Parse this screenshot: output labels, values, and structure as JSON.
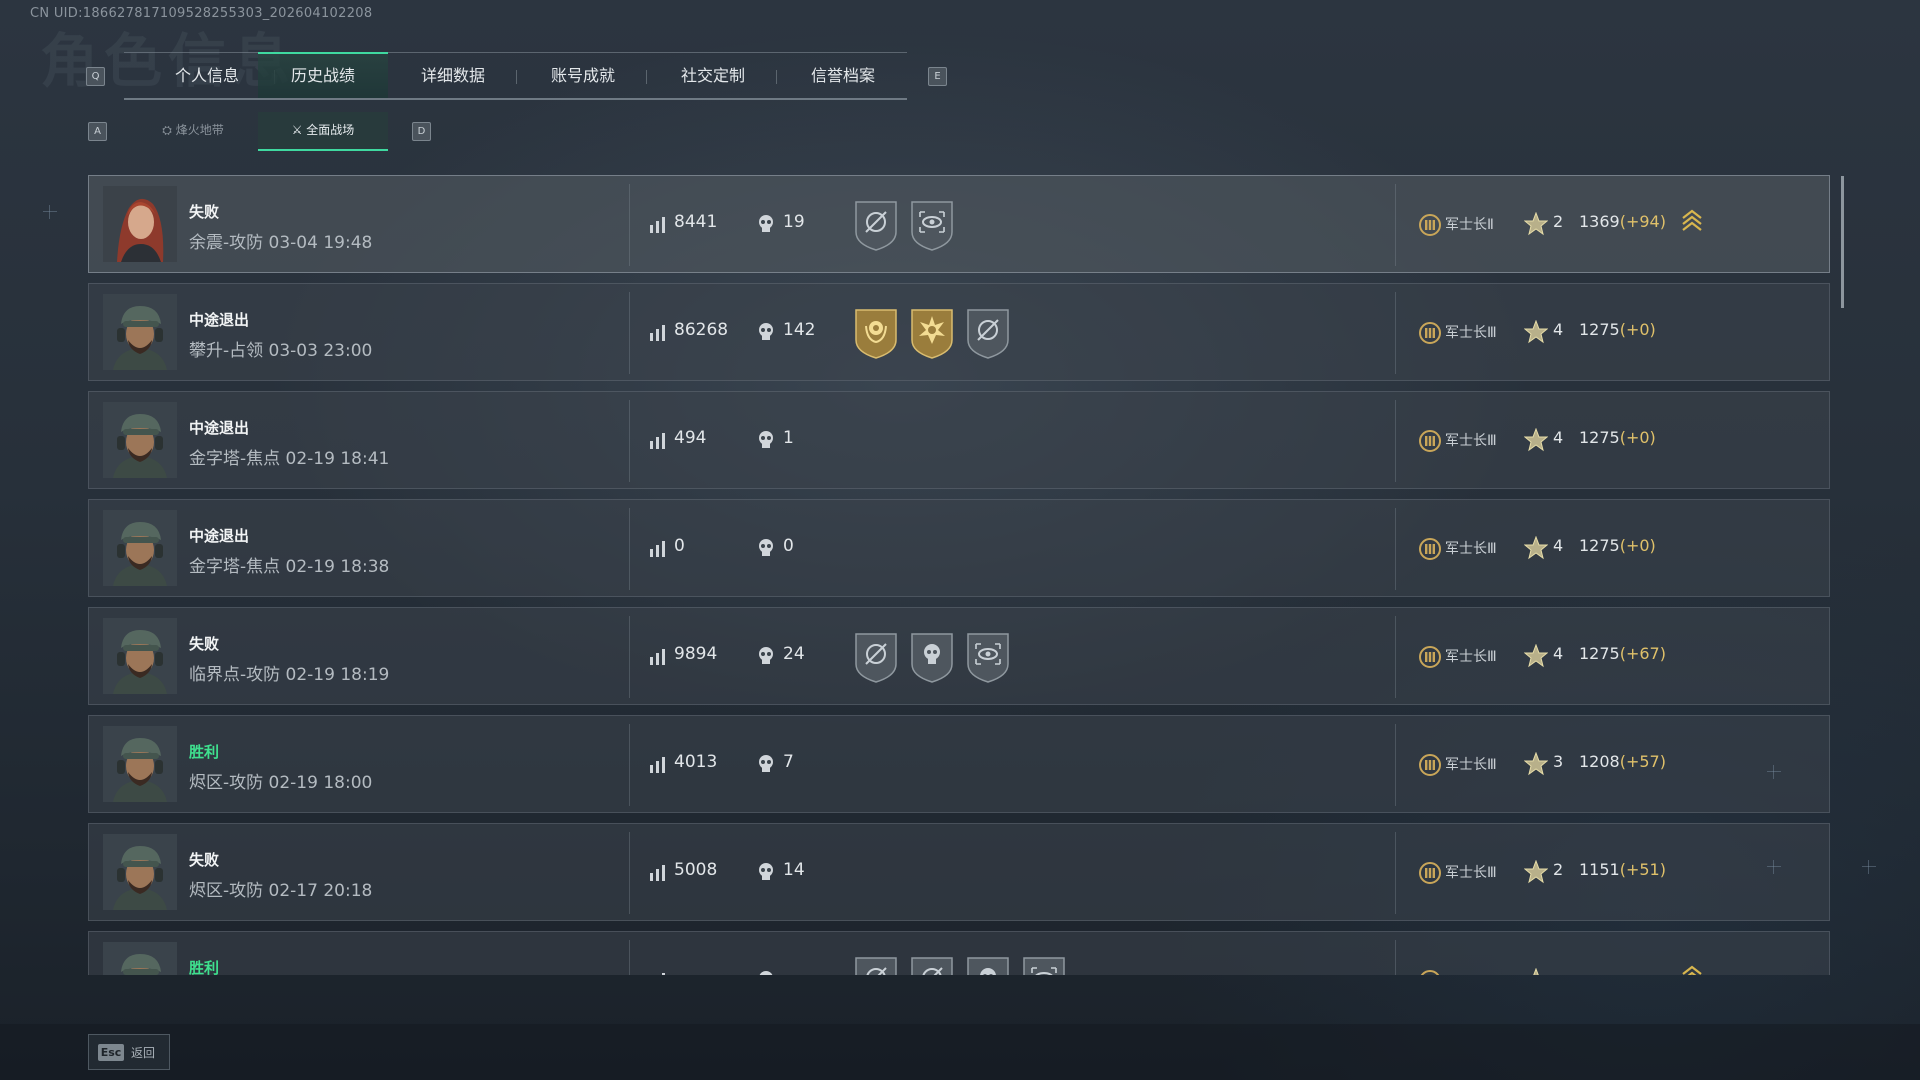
{
  "uid": "CN UID:186627817109528255303_202604102208",
  "ghost_title": "角色信息",
  "tabs": {
    "left_key": "Q",
    "right_key": "E",
    "items": [
      {
        "label": "个人信息",
        "active": false
      },
      {
        "label": "历史战绩",
        "active": true
      },
      {
        "label": "详细数据",
        "active": false
      },
      {
        "label": "账号成就",
        "active": false
      },
      {
        "label": "社交定制",
        "active": false
      },
      {
        "label": "信誉档案",
        "active": false
      }
    ]
  },
  "subtabs": {
    "left_key": "A",
    "right_key": "D",
    "items": [
      {
        "label": "烽火地带",
        "icon": "warzone-icon",
        "active": false
      },
      {
        "label": "全面战场",
        "icon": "battlefield-icon",
        "active": true
      }
    ]
  },
  "colors": {
    "accent": "#3fd9a0",
    "win": "#3fe08e",
    "delta": "#e0c16a",
    "gold": "#c9a659"
  },
  "matches": [
    {
      "result": "失败",
      "win": false,
      "map": "余震-攻防 03-04 19:48",
      "avatar": "female-operator",
      "score": "8441",
      "kills": "19",
      "badges": [
        "crosshair-shield-icon",
        "eye-shield-icon"
      ],
      "rank": "军士长Ⅱ",
      "level": "2",
      "rating": "1369",
      "delta": "(+94)",
      "chevron": true
    },
    {
      "result": "中途退出",
      "win": false,
      "map": "攀升-占领 03-03 23:00",
      "avatar": "male-operator",
      "score": "86268",
      "kills": "142",
      "badges": [
        "gold-wreath-badge-icon",
        "gold-explosion-badge-icon",
        "crosshair-shield-icon"
      ],
      "rank": "军士长Ⅲ",
      "level": "4",
      "rating": "1275",
      "delta": "(+0)",
      "chevron": false
    },
    {
      "result": "中途退出",
      "win": false,
      "map": "金字塔-焦点 02-19 18:41",
      "avatar": "male-operator",
      "score": "494",
      "kills": "1",
      "badges": [],
      "rank": "军士长Ⅲ",
      "level": "4",
      "rating": "1275",
      "delta": "(+0)",
      "chevron": false
    },
    {
      "result": "中途退出",
      "win": false,
      "map": "金字塔-焦点 02-19 18:38",
      "avatar": "male-operator",
      "score": "0",
      "kills": "0",
      "badges": [],
      "rank": "军士长Ⅲ",
      "level": "4",
      "rating": "1275",
      "delta": "(+0)",
      "chevron": false
    },
    {
      "result": "失败",
      "win": false,
      "map": "临界点-攻防 02-19 18:19",
      "avatar": "male-operator",
      "score": "9894",
      "kills": "24",
      "badges": [
        "crosshair-shield-icon",
        "skull-shield-icon",
        "eye-shield-icon"
      ],
      "rank": "军士长Ⅲ",
      "level": "4",
      "rating": "1275",
      "delta": "(+67)",
      "chevron": false
    },
    {
      "result": "胜利",
      "win": true,
      "map": "烬区-攻防 02-19 18:00",
      "avatar": "male-operator",
      "score": "4013",
      "kills": "7",
      "badges": [],
      "rank": "军士长Ⅲ",
      "level": "3",
      "rating": "1208",
      "delta": "(+57)",
      "chevron": false
    },
    {
      "result": "失败",
      "win": false,
      "map": "烬区-攻防 02-17 20:18",
      "avatar": "male-operator",
      "score": "5008",
      "kills": "14",
      "badges": [],
      "rank": "军士长Ⅲ",
      "level": "2",
      "rating": "1151",
      "delta": "(+51)",
      "chevron": false
    },
    {
      "result": "胜利",
      "win": true,
      "map": "",
      "avatar": "male-operator",
      "score": "",
      "kills": "",
      "badges": [
        "crosshair-shield-icon",
        "crosshair-shield-icon",
        "skull-shield-icon",
        "eye-shield-icon"
      ],
      "rank": "",
      "level": "",
      "rating": "",
      "delta": "",
      "chevron": true
    }
  ],
  "footer": {
    "esc_key": "Esc",
    "back_label": "返回"
  }
}
